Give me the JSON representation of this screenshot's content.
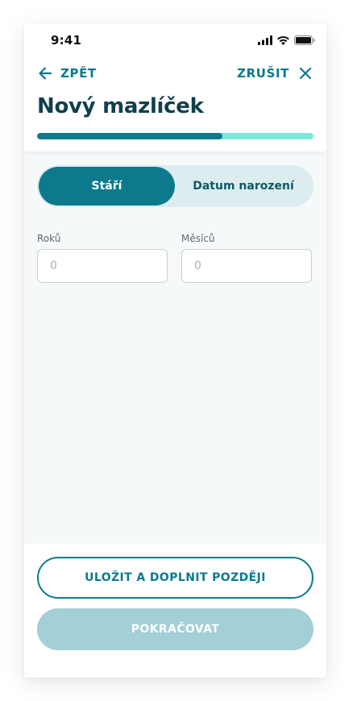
{
  "status_bar": {
    "time": "9:41",
    "icons": [
      "cellular-signal-icon",
      "wifi-icon",
      "battery-icon"
    ]
  },
  "nav": {
    "back_label": "ZPĚT",
    "cancel_label": "ZRUŠIT",
    "back_icon": "arrow-left-icon",
    "cancel_icon": "close-icon"
  },
  "header": {
    "title": "Nový mazlíček"
  },
  "progress": {
    "fraction": 0.67
  },
  "segmented": {
    "options": [
      "Stáří",
      "Datum narození"
    ],
    "selected": "Stáří"
  },
  "fields": {
    "years_label": "Roků",
    "years_placeholder": "0",
    "months_label": "Měsíců",
    "months_placeholder": "0"
  },
  "buttons": {
    "save_later": "ULOŽIT A DOPLNIT POZDĚJI",
    "continue": "POKRAČOVAT"
  },
  "colors": {
    "primary": "#0c7a8c",
    "title": "#103f4c",
    "progress_track": "#7ee8d8",
    "segment_track": "#dcecef",
    "disabled_button": "#a3cfd7",
    "background": "#f6f9fa"
  }
}
